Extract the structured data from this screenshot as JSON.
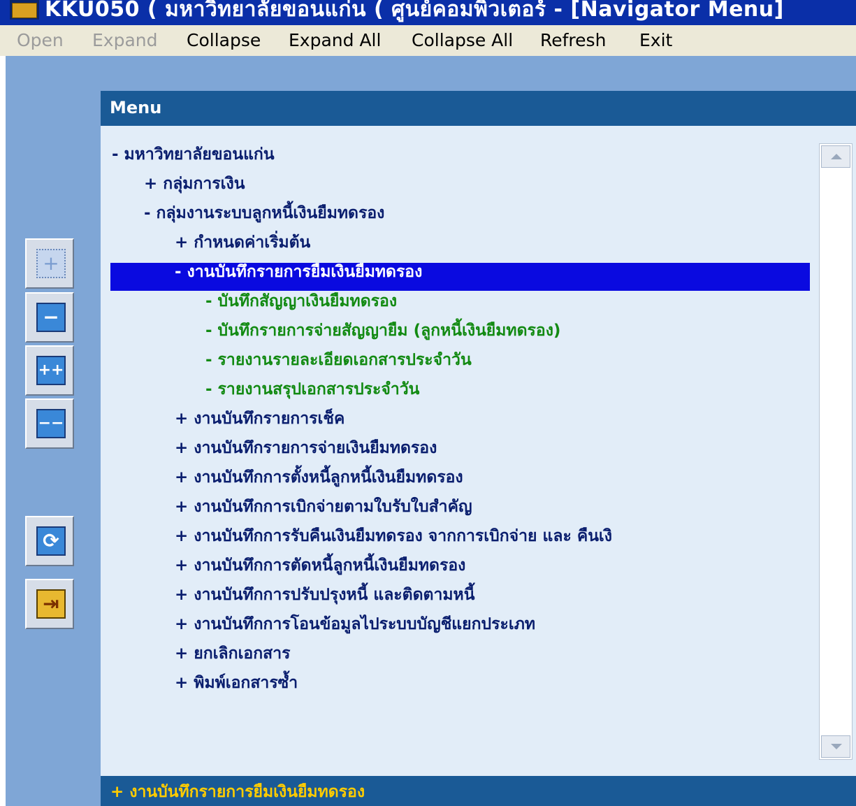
{
  "window": {
    "title": "KKU050 ( มหาวิทยาลัยขอนแก่น ( ศูนย์คอมพิวเตอร์ - [Navigator Menu]",
    "icon": "app-icon"
  },
  "menubar": {
    "open": "Open",
    "expand": "Expand",
    "collapse": "Collapse",
    "expand_all": "Expand All",
    "collapse_all": "Collapse All",
    "refresh": "Refresh",
    "exit": "Exit"
  },
  "toolbar": {
    "expand_icon": "plus-icon",
    "collapse_icon": "minus-icon",
    "expand_all_icon": "plus-plus-icon",
    "collapse_all_icon": "minus-minus-icon",
    "refresh_icon": "refresh-icon",
    "exit_icon": "exit-door-icon",
    "expand_glyph": "+",
    "collapse_glyph": "−",
    "expand_all_glyph": "++",
    "collapse_all_glyph": "−−",
    "refresh_glyph": "⟳",
    "exit_glyph": "⇥"
  },
  "panel": {
    "title": "Menu"
  },
  "tree": [
    {
      "text": "- มหาวิทยาลัยขอนแก่น",
      "level": 0,
      "style": "navy"
    },
    {
      "text": "+ กลุ่มการเงิน",
      "level": 1,
      "style": "navy"
    },
    {
      "text": "- กลุ่มงานระบบลูกหนี้เงินยืมทดรอง",
      "level": 1,
      "style": "navy"
    },
    {
      "text": "+ กำหนดค่าเริ่มต้น",
      "level": 2,
      "style": "navy"
    },
    {
      "text": "- งานบันทึกรายการยืมเงินยืมทดรอง",
      "level": 2,
      "style": "sel"
    },
    {
      "text": "- บันทึกสัญญาเงินยืมทดรอง",
      "level": 3,
      "style": "green"
    },
    {
      "text": "- บันทึกรายการจ่ายสัญญายืม (ลูกหนี้เงินยืมทดรอง)",
      "level": 3,
      "style": "green"
    },
    {
      "text": "- รายงานรายละเอียดเอกสารประจำวัน",
      "level": 3,
      "style": "green"
    },
    {
      "text": "- รายงานสรุปเอกสารประจำวัน",
      "level": 3,
      "style": "green"
    },
    {
      "text": "+ งานบันทึกรายการเช็ค",
      "level": 2,
      "style": "navy"
    },
    {
      "text": "+ งานบันทึกรายการจ่ายเงินยืมทดรอง",
      "level": 2,
      "style": "navy"
    },
    {
      "text": "+ งานบันทึกการตั้งหนี้ลูกหนี้เงินยืมทดรอง",
      "level": 2,
      "style": "navy"
    },
    {
      "text": "+ งานบันทึกการเบิกจ่ายตามใบรับใบสำคัญ",
      "level": 2,
      "style": "navy"
    },
    {
      "text": "+ งานบันทึกการรับคืนเงินยืมทดรอง จากการเบิกจ่าย และ คืนเงิ",
      "level": 2,
      "style": "navy"
    },
    {
      "text": "+ งานบันทึกการตัดหนี้ลูกหนี้เงินยืมทดรอง",
      "level": 2,
      "style": "navy"
    },
    {
      "text": "+ งานบันทึกการปรับปรุงหนี้ และติดตามหนี้",
      "level": 2,
      "style": "navy"
    },
    {
      "text": "+ งานบันทึกการโอนข้อมูลไประบบบัญชีแยกประเภท",
      "level": 2,
      "style": "navy"
    },
    {
      "text": "+ ยกเลิกเอกสาร",
      "level": 2,
      "style": "navy"
    },
    {
      "text": "+ พิมพ์เอกสารซ้ำ",
      "level": 2,
      "style": "navy"
    }
  ],
  "status": {
    "text": "+ งานบันทึกรายการยืมเงินยืมทดรอง"
  },
  "colors": {
    "title_bg": "#0a2fa8",
    "workarea_bg": "#7fa6d6",
    "panel_header_bg": "#1a5a96",
    "selection_bg": "#0a0ae0",
    "tree_navy": "#0a1e6e",
    "tree_green": "#128a12",
    "status_text": "#ffcc00"
  }
}
